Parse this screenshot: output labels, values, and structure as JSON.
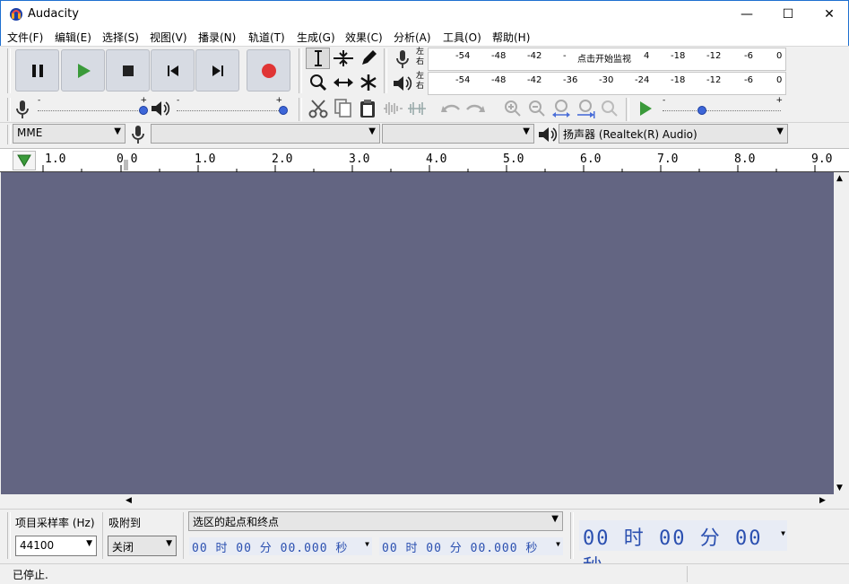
{
  "window": {
    "title": "Audacity",
    "minimize": "—",
    "maximize": "☐",
    "close": "✕"
  },
  "menu": [
    "文件(F)",
    "编辑(E)",
    "选择(S)",
    "视图(V)",
    "播录(N)",
    "轨道(T)",
    "生成(G)",
    "效果(C)",
    "分析(A)",
    "工具(O)",
    "帮助(H)"
  ],
  "transport": [
    "pause",
    "play",
    "stop",
    "skip-start",
    "skip-end",
    "record"
  ],
  "tools": {
    "row1": [
      "selection-tool",
      "envelope-tool",
      "draw-tool"
    ],
    "row2": [
      "zoom-tool",
      "timeshift-tool",
      "multi-tool"
    ]
  },
  "meters": {
    "channel_labels": [
      "左",
      "右"
    ],
    "record_ticks": [
      "-54",
      "-48",
      "-42",
      "-",
      "点击开始监视",
      "4",
      "-18",
      "-12",
      "-6",
      "0"
    ],
    "play_ticks": [
      "-54",
      "-48",
      "-42",
      "-36",
      "-30",
      "-24",
      "-18",
      "-12",
      "-6",
      "0"
    ]
  },
  "mixer": {
    "minus": "-",
    "plus": "+"
  },
  "playspeed": {
    "minus": "-",
    "plus": "+"
  },
  "device": {
    "host": "MME",
    "recording_device": "",
    "recording_channels": "",
    "playback_device": "扬声器 (Realtek(R) Audio)"
  },
  "ruler": {
    "labels": [
      "1.0",
      "0.0",
      "1.0",
      "2.0",
      "3.0",
      "4.0",
      "5.0",
      "6.0",
      "7.0",
      "8.0",
      "9.0"
    ]
  },
  "selection_bar": {
    "rate_label": "项目采样率 (Hz)",
    "rate_value": "44100",
    "snap_label": "吸附到",
    "snap_value": "关闭",
    "range_label": "选区的起点和终点",
    "start_time": "00 时 00 分 00.000 秒",
    "end_time": "00 时 00 分 00.000 秒"
  },
  "time_display": {
    "hours": "00",
    "h_unit": "时",
    "minutes": "00",
    "m_unit": "分",
    "seconds": "00",
    "s_unit": "秒"
  },
  "status": {
    "text": "已停止."
  },
  "colors": {
    "track_bg": "#636582",
    "accent": "#1e6fd0",
    "record": "#e03535",
    "play": "#3a9a3a",
    "time_text": "#2a4fb0"
  }
}
